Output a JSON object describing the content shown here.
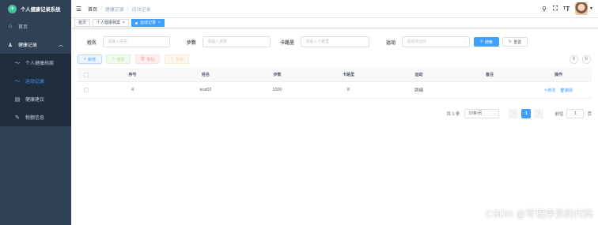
{
  "sidebar": {
    "brand": "个人健康记录系统",
    "home": "首页",
    "group": "健康记录",
    "items": [
      {
        "label": "个人健康档案"
      },
      {
        "label": "运动记录"
      },
      {
        "label": "健康建议"
      },
      {
        "label": "税额信息"
      }
    ]
  },
  "header": {
    "breadcrumb": [
      "首页",
      "健康记录",
      "运动记录"
    ]
  },
  "tags": {
    "items": [
      "首页",
      "个人健康档案",
      "运动记录"
    ]
  },
  "search": {
    "name_label": "姓名",
    "name_placeholder": "请输入姓名",
    "steps_label": "步数",
    "steps_placeholder": "请输入步数",
    "cal_label": "卡路里",
    "cal_placeholder": "请输入卡路里",
    "sport_label": "运动",
    "sport_placeholder": "请选择运动",
    "search_btn": "搜索",
    "reset_btn": "重置"
  },
  "toolbar": {
    "add": "新增",
    "edit": "修改",
    "delete": "删除",
    "export": "导出"
  },
  "table": {
    "columns": [
      "序号",
      "姓名",
      "步数",
      "卡路里",
      "运动",
      "备注",
      "操作"
    ],
    "rows": [
      {
        "index": "4",
        "name": "test02",
        "steps": "1000",
        "cal": "8",
        "sport": "跳绳",
        "remark": "",
        "edit": "修改",
        "delete": "删除"
      }
    ]
  },
  "pagination": {
    "total": "共 1 条",
    "page_size": "10条/页",
    "current": "1",
    "goto_label": "前往",
    "goto_value": "1",
    "page_suffix": "页"
  },
  "watermark": "CSDN @写程序员的代码",
  "colors": {
    "sidebar_bg": "#304156",
    "submenu_bg": "#1f2d3d",
    "primary": "#409eff",
    "logo": "#3cc59a"
  }
}
